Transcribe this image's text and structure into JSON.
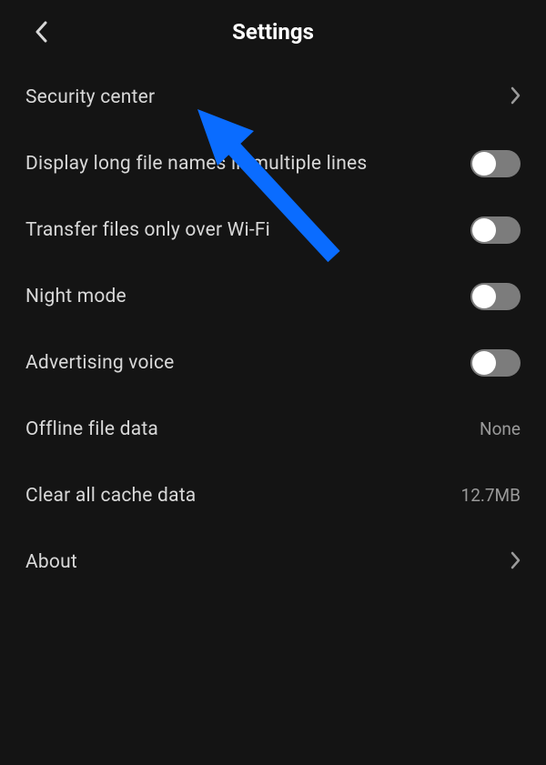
{
  "header": {
    "title": "Settings"
  },
  "rows": {
    "security": {
      "label": "Security center",
      "type": "chevron"
    },
    "displayLong": {
      "label": "Display long file names in multiple lines",
      "type": "toggle",
      "on": false
    },
    "wifi": {
      "label": "Transfer files only over Wi-Fi",
      "type": "toggle",
      "on": false
    },
    "night": {
      "label": "Night mode",
      "type": "toggle",
      "on": false
    },
    "adv": {
      "label": "Advertising voice",
      "type": "toggle",
      "on": false
    },
    "offline": {
      "label": "Offline file data",
      "type": "value",
      "value": "None"
    },
    "cache": {
      "label": "Clear all cache data",
      "type": "value",
      "value": "12.7MB"
    },
    "about": {
      "label": "About",
      "type": "chevron"
    }
  },
  "annotation": {
    "arrow_color": "#0a6cff"
  }
}
